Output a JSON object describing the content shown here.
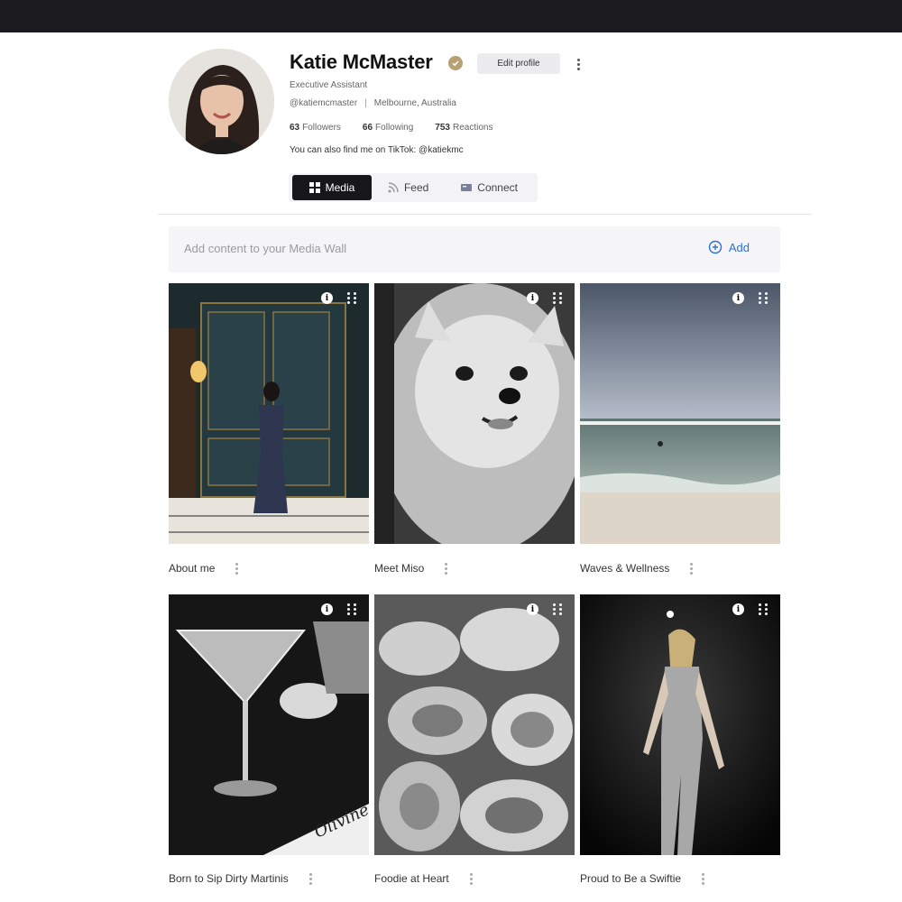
{
  "profile": {
    "name": "Katie McMaster",
    "edit_label": "Edit profile",
    "role": "Executive Assistant",
    "handle": "@katiemcmaster",
    "separator": "|",
    "location": "Melbourne, Australia",
    "stats": [
      {
        "count": "63",
        "label": "Followers"
      },
      {
        "count": "66",
        "label": "Following"
      },
      {
        "count": "753",
        "label": "Reactions"
      }
    ],
    "bio": "You can also find me on TikTok: @katiekmc"
  },
  "tabs": [
    {
      "label": "Media",
      "icon": "grid-icon",
      "active": true
    },
    {
      "label": "Feed",
      "icon": "rss-icon",
      "active": false
    },
    {
      "label": "Connect",
      "icon": "card-icon",
      "active": false
    }
  ],
  "media_wall": {
    "placeholder": "Add content to your Media Wall",
    "add_label": "Add"
  },
  "cards": [
    {
      "title": "About me"
    },
    {
      "title": "Meet Miso"
    },
    {
      "title": "Waves & Wellness"
    },
    {
      "title": "Born to Sip Dirty Martinis"
    },
    {
      "title": "Foodie at Heart"
    },
    {
      "title": "Proud to Be a Swiftie"
    }
  ],
  "colors": {
    "topbar": "#1b1b1f",
    "accent": "#2f6fd6",
    "verified": "#b8a070",
    "active_tab": "#17171b"
  }
}
